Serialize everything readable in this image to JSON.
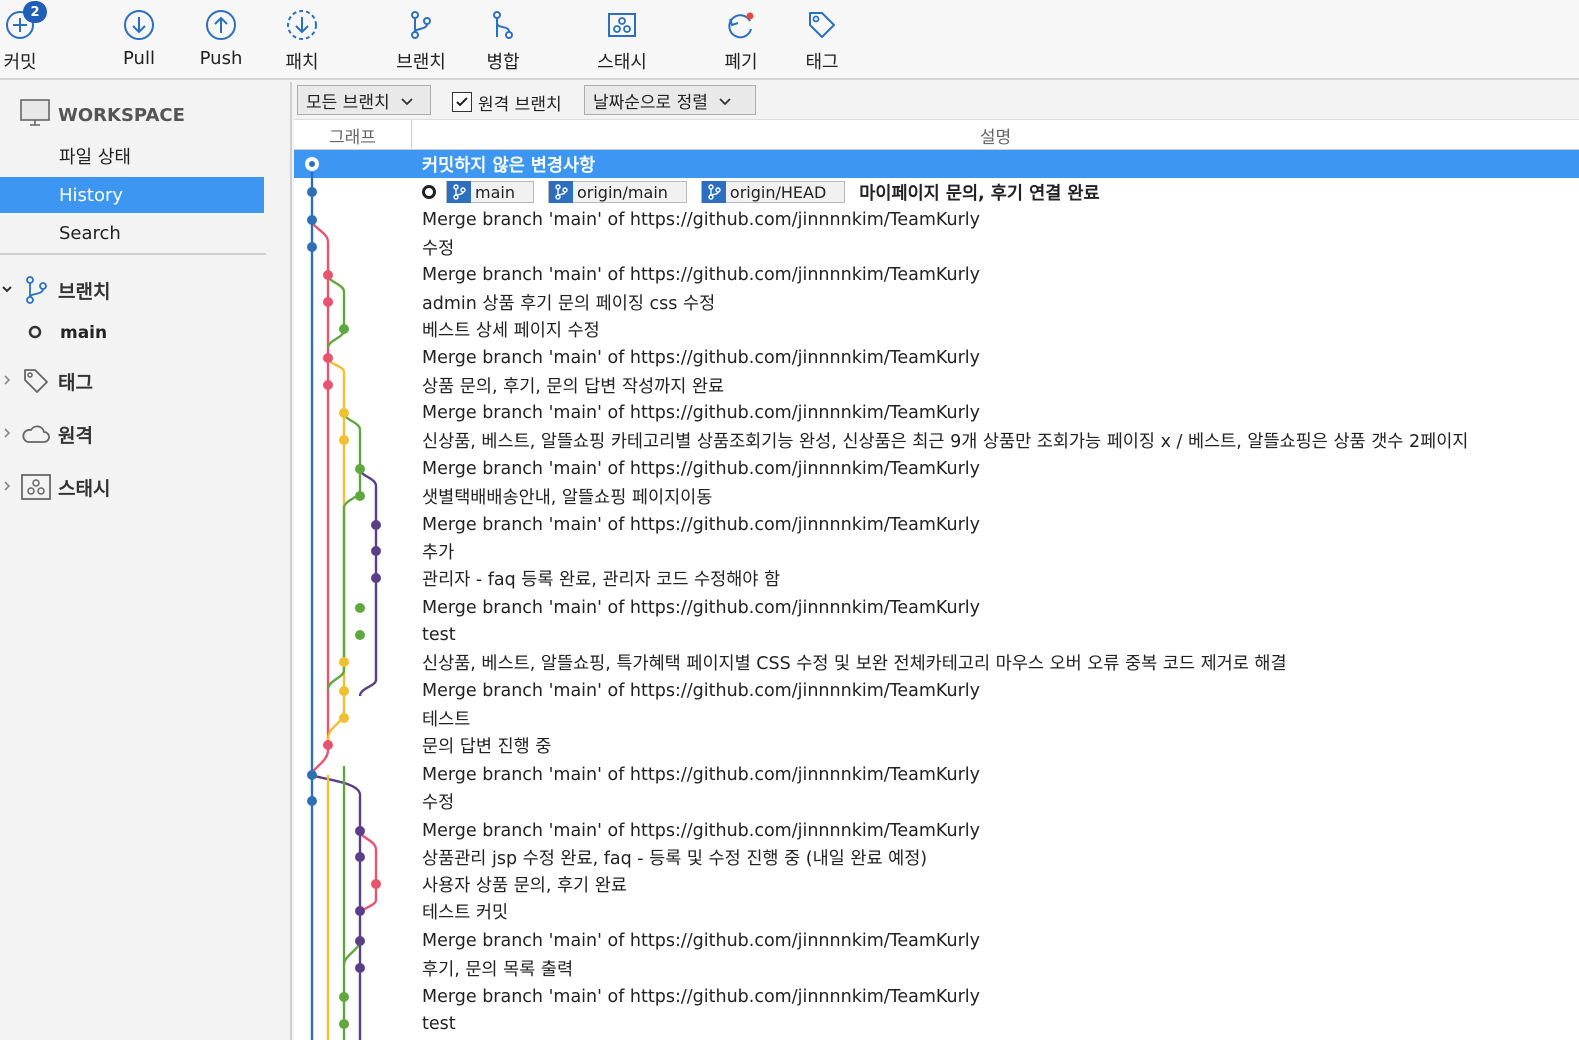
{
  "toolbar": {
    "commit": {
      "label": "커밋",
      "badge": "2",
      "icon": "plus-circle-icon"
    },
    "pull": {
      "label": "Pull",
      "icon": "arrow-down-circle-icon"
    },
    "push": {
      "label": "Push",
      "icon": "arrow-up-circle-icon"
    },
    "fetch": {
      "label": "패치",
      "icon": "dashed-arrow-down-circle-icon"
    },
    "branch": {
      "label": "브랜치",
      "icon": "branch-icon"
    },
    "merge": {
      "label": "병합",
      "icon": "merge-icon"
    },
    "stash": {
      "label": "스태시",
      "icon": "stash-icon"
    },
    "discard": {
      "label": "폐기",
      "icon": "discard-icon"
    },
    "tag": {
      "label": "태그",
      "icon": "tag-icon"
    }
  },
  "sidebar": {
    "workspace": "WORKSPACE",
    "items": [
      {
        "label": "파일 상태",
        "active": false
      },
      {
        "label": "History",
        "active": true
      },
      {
        "label": "Search",
        "active": false
      }
    ],
    "branches_label": "브랜치",
    "current_branch": "main",
    "tags_label": "태그",
    "remotes_label": "원격",
    "stashes_label": "스태시"
  },
  "filter": {
    "branches_dropdown": "모든 브랜치",
    "remote_checkbox_label": "원격 브랜치",
    "remote_checked": true,
    "sort_dropdown": "날짜순으로 정렬"
  },
  "columns": {
    "graph": "그래프",
    "description": "설명"
  },
  "commits": [
    {
      "text": "커밋하지 않은 변경사항"
    },
    {
      "text": "마이페이지 문의, 후기 연결 완료",
      "refs": [
        "main",
        "origin/main",
        "origin/HEAD"
      ]
    },
    {
      "text": "Merge branch 'main' of https://github.com/jinnnnkim/TeamKurly"
    },
    {
      "text": "수정"
    },
    {
      "text": "Merge branch 'main' of https://github.com/jinnnnkim/TeamKurly"
    },
    {
      "text": "admin 상품 후기 문의 페이징 css 수정"
    },
    {
      "text": "베스트 상세 페이지 수정"
    },
    {
      "text": "Merge branch 'main' of https://github.com/jinnnnkim/TeamKurly"
    },
    {
      "text": "상품 문의, 후기, 문의 답변 작성까지 완료"
    },
    {
      "text": "Merge branch 'main' of https://github.com/jinnnnkim/TeamKurly"
    },
    {
      "text": "신상품, 베스트, 알뜰쇼핑 카테고리별 상품조회기능 완성, 신상품은 최근 9개 상품만 조회가능 페이징 x / 베스트, 알뜰쇼핑은 상품 갯수 2페이지"
    },
    {
      "text": "Merge branch 'main' of https://github.com/jinnnnkim/TeamKurly"
    },
    {
      "text": "샛별택배배송안내, 알뜰쇼핑 페이지이동"
    },
    {
      "text": "Merge branch 'main' of https://github.com/jinnnnkim/TeamKurly"
    },
    {
      "text": "추가"
    },
    {
      "text": "관리자 - faq 등록 완료, 관리자 코드 수정해야 함"
    },
    {
      "text": "Merge branch 'main' of https://github.com/jinnnnkim/TeamKurly"
    },
    {
      "text": "test"
    },
    {
      "text": "신상품, 베스트, 알뜰쇼핑, 특가혜택 페이지별 CSS 수정 및 보완 전체카테고리 마우스 오버 오류 중복 코드 제거로 해결"
    },
    {
      "text": "Merge branch 'main' of https://github.com/jinnnnkim/TeamKurly"
    },
    {
      "text": "테스트"
    },
    {
      "text": "문의 답변 진행 중"
    },
    {
      "text": "Merge branch 'main' of https://github.com/jinnnnkim/TeamKurly"
    },
    {
      "text": "수정"
    },
    {
      "text": "Merge branch 'main' of https://github.com/jinnnnkim/TeamKurly"
    },
    {
      "text": "상품관리 jsp 수정 완료, faq - 등록 및 수정 진행 중 (내일 완료 예정)"
    },
    {
      "text": "사용자 상품 문의, 후기 완료"
    },
    {
      "text": "테스트 커밋"
    },
    {
      "text": "Merge branch 'main' of https://github.com/jinnnnkim/TeamKurly"
    },
    {
      "text": "후기, 문의 목록 출력"
    },
    {
      "text": "Merge branch 'main' of https://github.com/jinnnnkim/TeamKurly"
    },
    {
      "text": "test"
    }
  ],
  "graph_colors": {
    "blue": "#2f6fb5",
    "red": "#e8546f",
    "green": "#5fa83e",
    "yellow": "#f0c030",
    "purple": "#5a3f86"
  }
}
